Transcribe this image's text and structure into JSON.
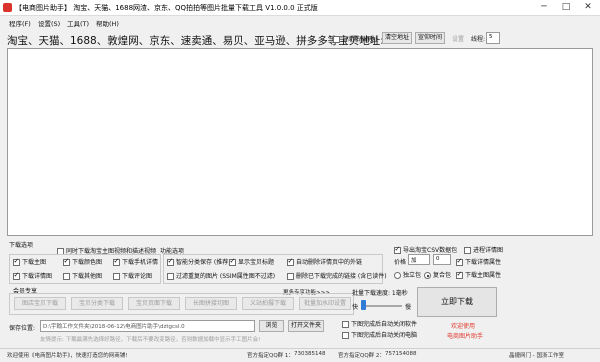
{
  "window": {
    "title": "【电商图片助手】 淘宝、天猫、1688网渣、京东、QQ拍拍等图片批量下载工具 V1.0.0.0 正式版",
    "minimize": "─",
    "maximize": "□",
    "close": "✕"
  },
  "menu": [
    "程序(F)",
    "设置(S)",
    "工具(T)",
    "帮助(H)"
  ],
  "url_row": {
    "label": "淘宝、天猫、1688、敦煌网、京东、速卖通、易贝、亚马逊、拼多多等宝贝地址:",
    "auto_paste_label": "自动粘贴网址",
    "auto_paste_checked": false,
    "clear_button": "清空地址",
    "retry_button": "宣仰时间",
    "settings": "设置",
    "threads_label": "线程:",
    "threads_value": "5"
  },
  "download_options": {
    "title": "下载选项",
    "group_checkbox": "同时下载淘宝主图视频和描述视频",
    "items": [
      {
        "label": "下载主图",
        "checked": true
      },
      {
        "label": "下载颜色图",
        "checked": true
      },
      {
        "label": "下载手机详情",
        "checked": true
      },
      {
        "label": "下载详情图",
        "checked": true
      },
      {
        "label": "下载其他图",
        "checked": false
      },
      {
        "label": "下载评论图",
        "checked": false
      }
    ]
  },
  "function_options": {
    "title": "功能选项",
    "items": [
      {
        "label": "智能分类保存 (推荐)",
        "checked": true
      },
      {
        "label": "显示宝贝标题",
        "checked": true
      },
      {
        "label": "自动删除详情页中的外链",
        "checked": true
      },
      {
        "label": "过滤重复的图片 (SSIM属性图不过滤)",
        "checked": false
      },
      {
        "label": "删除已下载完成的链接 (含已读件)",
        "checked": false
      }
    ]
  },
  "right_options": {
    "export_csv": {
      "label": "导出淘宝CSV数据包",
      "checked": true
    },
    "detail_progress": {
      "label": "进程详情图",
      "checked": false
    },
    "price_label": "价格",
    "price_op": "加",
    "price_value": "0",
    "download_detail_attr": {
      "label": "下载详情属性",
      "checked": true
    },
    "single_position": {
      "label": "独立包",
      "checked": false
    },
    "merge_table": {
      "label": "复合包",
      "checked": true
    },
    "download_main_attr": {
      "label": "下载主图属性",
      "checked": true
    }
  },
  "member": {
    "title": "会员专享",
    "more": "更多专享功能>>>",
    "buttons": [
      "图店宝贝下载",
      "宝贝分类下载",
      "宝贝页面下载",
      "长图拼接切图",
      "义站拍摄下载",
      "批量加水印设置"
    ]
  },
  "batch": {
    "speed_label": "批量下载速度: 1毫秒",
    "slow": "快",
    "fast": "慢",
    "speed_level": 0.03,
    "download_button": "立即下载",
    "close_after": {
      "label": "下图完成后自动关闭软件",
      "checked": false
    },
    "shutdown_after": {
      "label": "下图完成后自动关闭电脑",
      "checked": false
    },
    "welcome": "欢迎使用",
    "product": "电商图片助手"
  },
  "save": {
    "label": "保存位置:",
    "path": "D:\\宇翰工作文件夹\\2018-06-12\\电商图片助手\\dztgcsl.0",
    "browse": "浏览",
    "open_folder": "打开文件夹",
    "hint": "友情提示: 下载最满先选择好路径，下载后不要改变路径，否则数据加载中显示手工图片会!"
  },
  "status": {
    "welcome": "欢迎使用《电商图片助手》，快速打造您的网商铺!",
    "qq1_label": "官方指定QQ群 1：",
    "qq1": "730385148",
    "qq2_label": "官方指定QQ群 2：",
    "qq2": "757154088",
    "vendor": "晶捷网门 - 国浙工作室"
  }
}
